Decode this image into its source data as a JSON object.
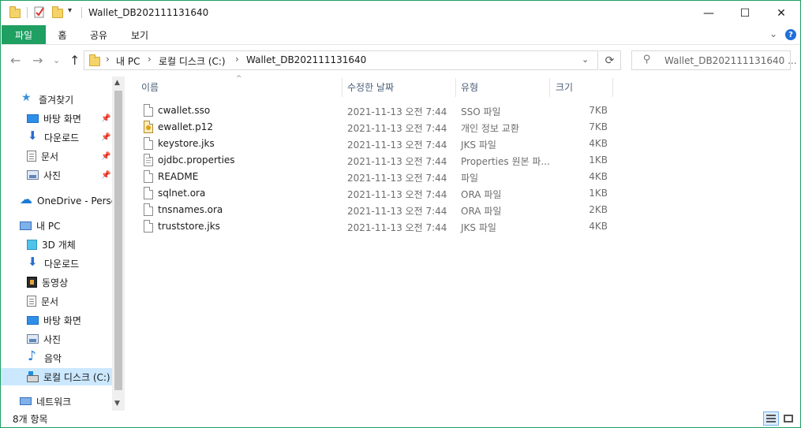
{
  "titlebar": {
    "title": "Wallet_DB202111131640",
    "qa_dropdown": "▾",
    "minimize": "—",
    "maximize": "☐",
    "close": "✕"
  },
  "ribbon": {
    "tabs": [
      "파일",
      "홈",
      "공유",
      "보기"
    ],
    "collapse": "⌄",
    "help": "?"
  },
  "nav": {
    "back": "←",
    "forward": "→",
    "recent": "⌄",
    "up": "↑",
    "breadcrumb": [
      "내 PC",
      "로컬 디스크 (C:)",
      "Wallet_DB202111131640"
    ],
    "chev": "›",
    "dropdown": "⌄",
    "refresh": "⟳",
    "search_icon": "⚲",
    "search_placeholder": "Wallet_DB202111131640 ..."
  },
  "sidebar": {
    "items": [
      {
        "label": "즐겨찾기",
        "icon": "star-icon",
        "pinned": false
      },
      {
        "label": "바탕 화면",
        "icon": "desktop-icon",
        "pinned": true
      },
      {
        "label": "다운로드",
        "icon": "download-icon",
        "pinned": true
      },
      {
        "label": "문서",
        "icon": "document-icon",
        "pinned": true
      },
      {
        "label": "사진",
        "icon": "pictures-icon",
        "pinned": true
      },
      {
        "label": "OneDrive - Person",
        "icon": "onedrive-icon",
        "pinned": false
      },
      {
        "label": "내 PC",
        "icon": "pc-icon",
        "pinned": false
      },
      {
        "label": "3D 개체",
        "icon": "3d-objects-icon",
        "pinned": false
      },
      {
        "label": "다운로드",
        "icon": "download-icon",
        "pinned": false
      },
      {
        "label": "동영상",
        "icon": "video-icon",
        "pinned": false
      },
      {
        "label": "문서",
        "icon": "document-icon",
        "pinned": false
      },
      {
        "label": "바탕 화면",
        "icon": "desktop-icon",
        "pinned": false
      },
      {
        "label": "사진",
        "icon": "pictures-icon",
        "pinned": false
      },
      {
        "label": "음악",
        "icon": "music-icon",
        "pinned": false
      },
      {
        "label": "로컬 디스크 (C:)",
        "icon": "drive-icon",
        "pinned": false
      },
      {
        "label": "네트워크",
        "icon": "network-icon",
        "pinned": false
      }
    ],
    "pin_glyph": "📌",
    "scroll_up": "▲",
    "scroll_down": "▼"
  },
  "columns": {
    "sort_indicator": "^",
    "name": "이름",
    "date": "수정한 날짜",
    "type": "유형",
    "size": "크기"
  },
  "files": [
    {
      "name": "cwallet.sso",
      "date": "2021-11-13 오전 7:44",
      "type": "SSO 파일",
      "size": "7KB",
      "icon": "file-icon"
    },
    {
      "name": "ewallet.p12",
      "date": "2021-11-13 오전 7:44",
      "type": "개인 정보 교환",
      "size": "7KB",
      "icon": "certificate-file-icon"
    },
    {
      "name": "keystore.jks",
      "date": "2021-11-13 오전 7:44",
      "type": "JKS 파일",
      "size": "4KB",
      "icon": "file-icon"
    },
    {
      "name": "ojdbc.properties",
      "date": "2021-11-13 오전 7:44",
      "type": "Properties 원본 파...",
      "size": "1KB",
      "icon": "properties-file-icon"
    },
    {
      "name": "README",
      "date": "2021-11-13 오전 7:44",
      "type": "파일",
      "size": "4KB",
      "icon": "file-icon"
    },
    {
      "name": "sqlnet.ora",
      "date": "2021-11-13 오전 7:44",
      "type": "ORA 파일",
      "size": "1KB",
      "icon": "file-icon"
    },
    {
      "name": "tnsnames.ora",
      "date": "2021-11-13 오전 7:44",
      "type": "ORA 파일",
      "size": "2KB",
      "icon": "file-icon"
    },
    {
      "name": "truststore.jks",
      "date": "2021-11-13 오전 7:44",
      "type": "JKS 파일",
      "size": "4KB",
      "icon": "file-icon"
    }
  ],
  "status": {
    "count": "8개 항목"
  },
  "colors": {
    "accent": "#1f9f62",
    "selected": "#cce8ff"
  }
}
